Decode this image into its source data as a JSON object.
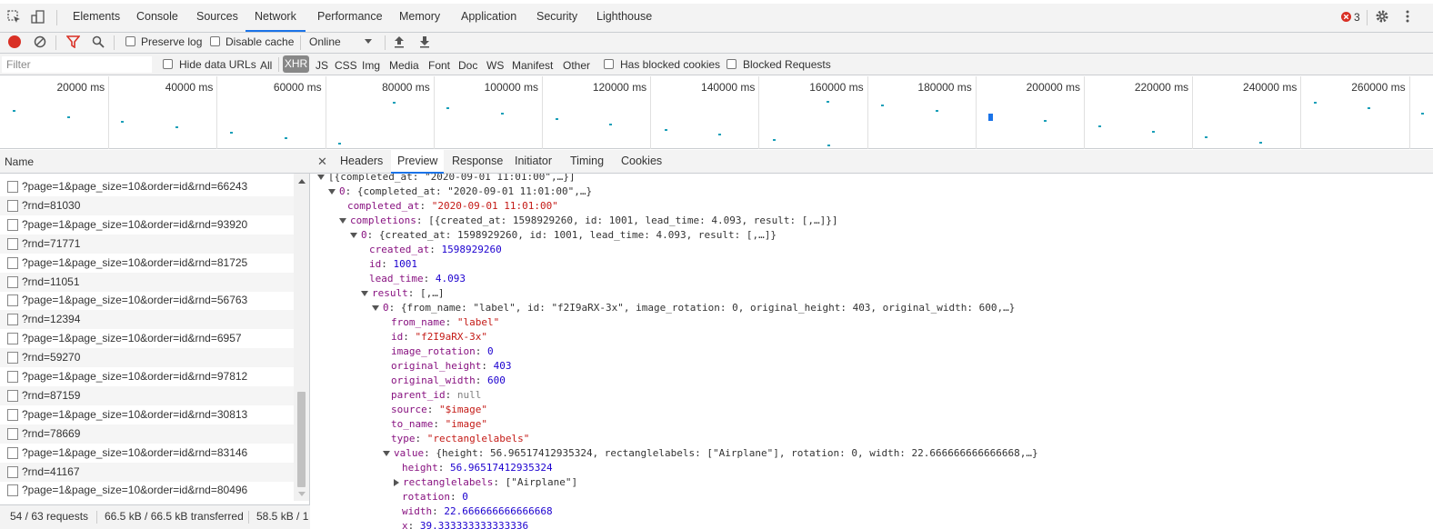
{
  "tabs": [
    "Elements",
    "Console",
    "Sources",
    "Network",
    "Performance",
    "Memory",
    "Application",
    "Security",
    "Lighthouse"
  ],
  "active_tab": "Network",
  "error_count": "3",
  "toolbar": {
    "preserve_log": "Preserve log",
    "disable_cache": "Disable cache",
    "throttle": "Online"
  },
  "filterbar": {
    "placeholder": "Filter",
    "hide_data_urls": "Hide data URLs",
    "types": [
      "All",
      "XHR",
      "JS",
      "CSS",
      "Img",
      "Media",
      "Font",
      "Doc",
      "WS",
      "Manifest",
      "Other"
    ],
    "active_type": "XHR",
    "has_blocked_cookies": "Has blocked cookies",
    "blocked_requests": "Blocked Requests"
  },
  "overview": {
    "labels": [
      "20000 ms",
      "40000 ms",
      "60000 ms",
      "80000 ms",
      "100000 ms",
      "120000 ms",
      "140000 ms",
      "160000 ms",
      "180000 ms",
      "200000 ms",
      "220000 ms",
      "240000 ms",
      "260000 ms"
    ]
  },
  "requests": {
    "header": "Name",
    "rows": [
      "?page=1&page_size=10&order=id&rnd=66243",
      "?rnd=81030",
      "?page=1&page_size=10&order=id&rnd=93920",
      "?rnd=71771",
      "?page=1&page_size=10&order=id&rnd=81725",
      "?rnd=11051",
      "?page=1&page_size=10&order=id&rnd=56763",
      "?rnd=12394",
      "?page=1&page_size=10&order=id&rnd=6957",
      "?rnd=59270",
      "?page=1&page_size=10&order=id&rnd=97812",
      "?rnd=87159",
      "?page=1&page_size=10&order=id&rnd=30813",
      "?rnd=78669",
      "?page=1&page_size=10&order=id&rnd=83146",
      "?rnd=41167",
      "?page=1&page_size=10&order=id&rnd=80496"
    ],
    "status_requests": "54 / 63 requests",
    "status_transferred": "66.5 kB / 66.5 kB transferred",
    "status_resources": "58.5 kB / 1"
  },
  "detail_tabs": [
    "Headers",
    "Preview",
    "Response",
    "Initiator",
    "Timing",
    "Cookies"
  ],
  "active_detail_tab": "Preview",
  "preview": {
    "l0": "[{completed_at: \"2020-09-01 11:01:00\",…}]",
    "l1_key": "0",
    "l1_val": "{completed_at: \"2020-09-01 11:01:00\",…}",
    "completed_at_key": "completed_at",
    "completed_at_val": "\"2020-09-01 11:01:00\"",
    "completions_key": "completions",
    "completions_val": "[{created_at: 1598929260, id: 1001, lead_time: 4.093, result: [,…]}]",
    "c0_key": "0",
    "c0_val": "{created_at: 1598929260, id: 1001, lead_time: 4.093, result: [,…]}",
    "created_at_key": "created_at",
    "created_at_val": "1598929260",
    "id_key": "id",
    "id_val": "1001",
    "lead_time_key": "lead_time",
    "lead_time_val": "4.093",
    "result_key": "result",
    "result_val": "[,…]",
    "r0_key": "0",
    "r0_val": "{from_name: \"label\", id: \"f2I9aRX-3x\", image_rotation: 0, original_height: 403, original_width: 600,…}",
    "from_name_key": "from_name",
    "from_name_val": "\"label\"",
    "rid_key": "id",
    "rid_val": "\"f2I9aRX-3x\"",
    "image_rotation_key": "image_rotation",
    "image_rotation_val": "0",
    "original_height_key": "original_height",
    "original_height_val": "403",
    "original_width_key": "original_width",
    "original_width_val": "600",
    "parent_id_key": "parent_id",
    "parent_id_val": "null",
    "source_key": "source",
    "source_val": "\"$image\"",
    "to_name_key": "to_name",
    "to_name_val": "\"image\"",
    "type_key": "type",
    "type_val": "\"rectanglelabels\"",
    "value_key": "value",
    "value_val": "{height: 56.96517412935324, rectanglelabels: [\"Airplane\"], rotation: 0, width: 22.666666666666668,…}",
    "height_key": "height",
    "height_val": "56.96517412935324",
    "rectanglelabels_key": "rectanglelabels",
    "rectanglelabels_val": "[\"Airplane\"]",
    "rotation_key": "rotation",
    "rotation_val": "0",
    "width_key": "width",
    "width_val": "22.666666666666668",
    "x_key": "x",
    "x_val": "39.333333333333336"
  },
  "colors": {
    "accent": "#1a73e8",
    "record": "#d93025",
    "json_key": "#881280",
    "json_string": "#c41a16",
    "json_number": "#1c00cf"
  }
}
